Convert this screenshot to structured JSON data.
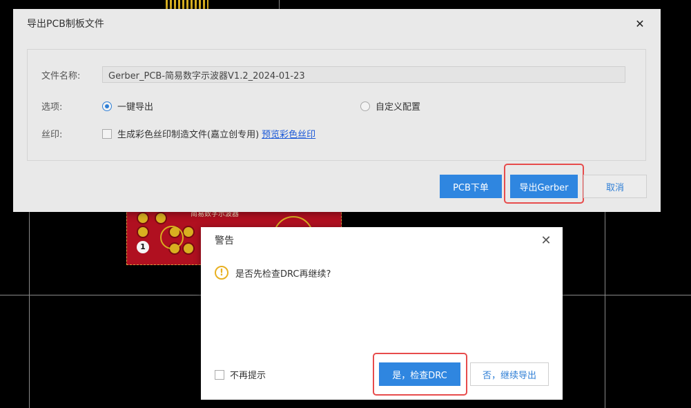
{
  "export_dialog": {
    "title": "导出PCB制板文件",
    "filename_label": "文件名称:",
    "filename_value": "Gerber_PCB-简易数字示波器V1.2_2024-01-23",
    "options_label": "选项:",
    "option_one_click": "一键导出",
    "option_custom": "自定义配置",
    "silk_label": "丝印:",
    "silk_checkbox_label": "生成彩色丝印制造文件(嘉立创专用)",
    "silk_preview_link": "预览彩色丝印",
    "btn_pcb_order": "PCB下单",
    "btn_export_gerber": "导出Gerber",
    "btn_cancel": "取消"
  },
  "warning_dialog": {
    "title": "警告",
    "message": "是否先检查DRC再继续?",
    "dont_remind": "不再提示",
    "btn_yes_check": "是，检查DRC",
    "btn_no_continue": "否，继续导出"
  },
  "pcb": {
    "silk_title": "简易数字示波器",
    "pad_number": "1"
  },
  "colors": {
    "primary": "#2f86e0",
    "highlight": "#e74b4b",
    "warning": "#e8b021",
    "pcb_red": "#b01020"
  }
}
